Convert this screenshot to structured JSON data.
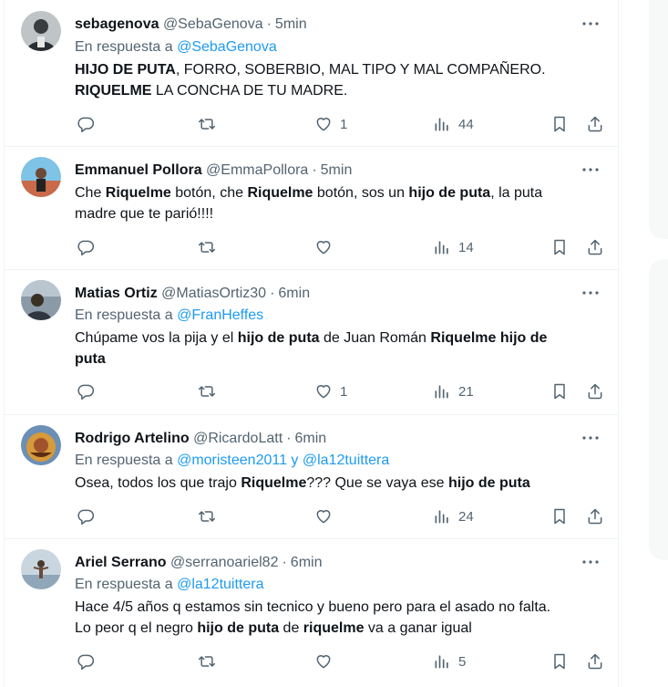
{
  "tweets": [
    {
      "name": "sebagenova",
      "handle": "@SebaGenova",
      "time": "5min",
      "reply_prefix": "En respuesta a",
      "reply_to": "@SebaGenova",
      "text_line1_bold": "HIJO DE PUTA",
      "text_line1_rest": ", FORRO, SOBERBIO, MAL TIPO Y MAL COMPAÑERO.",
      "text_line2_bold": "RIQUELME",
      "text_line2_rest": " LA CONCHA DE TU MADRE.",
      "likes": "1",
      "views": "44"
    },
    {
      "name": "Emmanuel Pollora",
      "handle": "@EmmaPollora",
      "time": "5min",
      "seg1": "Che ",
      "seg2": "Riquelme",
      "seg3": " botón, che ",
      "seg4": "Riquelme",
      "seg5": " botón, sos un ",
      "seg6": "hijo de puta",
      "seg7": ", la puta",
      "line2": "madre que te parió!!!!",
      "likes": "",
      "views": "14"
    },
    {
      "name": "Matias Ortiz",
      "handle": "@MatiasOrtiz30",
      "time": "6min",
      "reply_prefix": "En respuesta a",
      "reply_to": "@FranHeffes",
      "seg1": "Chúpame vos la pija y el ",
      "seg2": "hijo de puta",
      "seg3": " de Juan Román ",
      "seg4": "Riquelme hijo de",
      "line2": "puta",
      "likes": "1",
      "views": "21"
    },
    {
      "name": "Rodrigo Artelino",
      "handle": "@RicardoLatt",
      "time": "6min",
      "reply_prefix": "En respuesta a",
      "reply_to": "@moristeen2011 y @la12tuittera",
      "seg1": "Osea, todos los que trajo ",
      "seg2": "Riquelme",
      "seg3": "??? Que se vaya ese ",
      "seg4": "hijo de puta",
      "likes": "",
      "views": "24"
    },
    {
      "name": "Ariel Serrano",
      "handle": "@serranoariel82",
      "time": "6min",
      "reply_prefix": "En respuesta a",
      "reply_to": "@la12tuittera",
      "line1": "Hace 4/5 años q estamos sin tecnico y bueno pero para el asado no falta.",
      "seg1": "Lo peor q el negro ",
      "seg2": "hijo de puta",
      "seg3": " de ",
      "seg4": "riquelme",
      "seg5": " va a ganar igual",
      "likes": "",
      "views": "5"
    }
  ],
  "separator": "·",
  "icons": {
    "reply": "reply-icon",
    "retweet": "retweet-icon",
    "like": "heart-icon",
    "views": "views-icon",
    "bookmark": "bookmark-icon",
    "share": "share-icon",
    "more": "more-icon"
  },
  "colors": {
    "text": "#0f1419",
    "secondary": "#536471",
    "link": "#1d9bf0",
    "border": "#eff3f4"
  }
}
